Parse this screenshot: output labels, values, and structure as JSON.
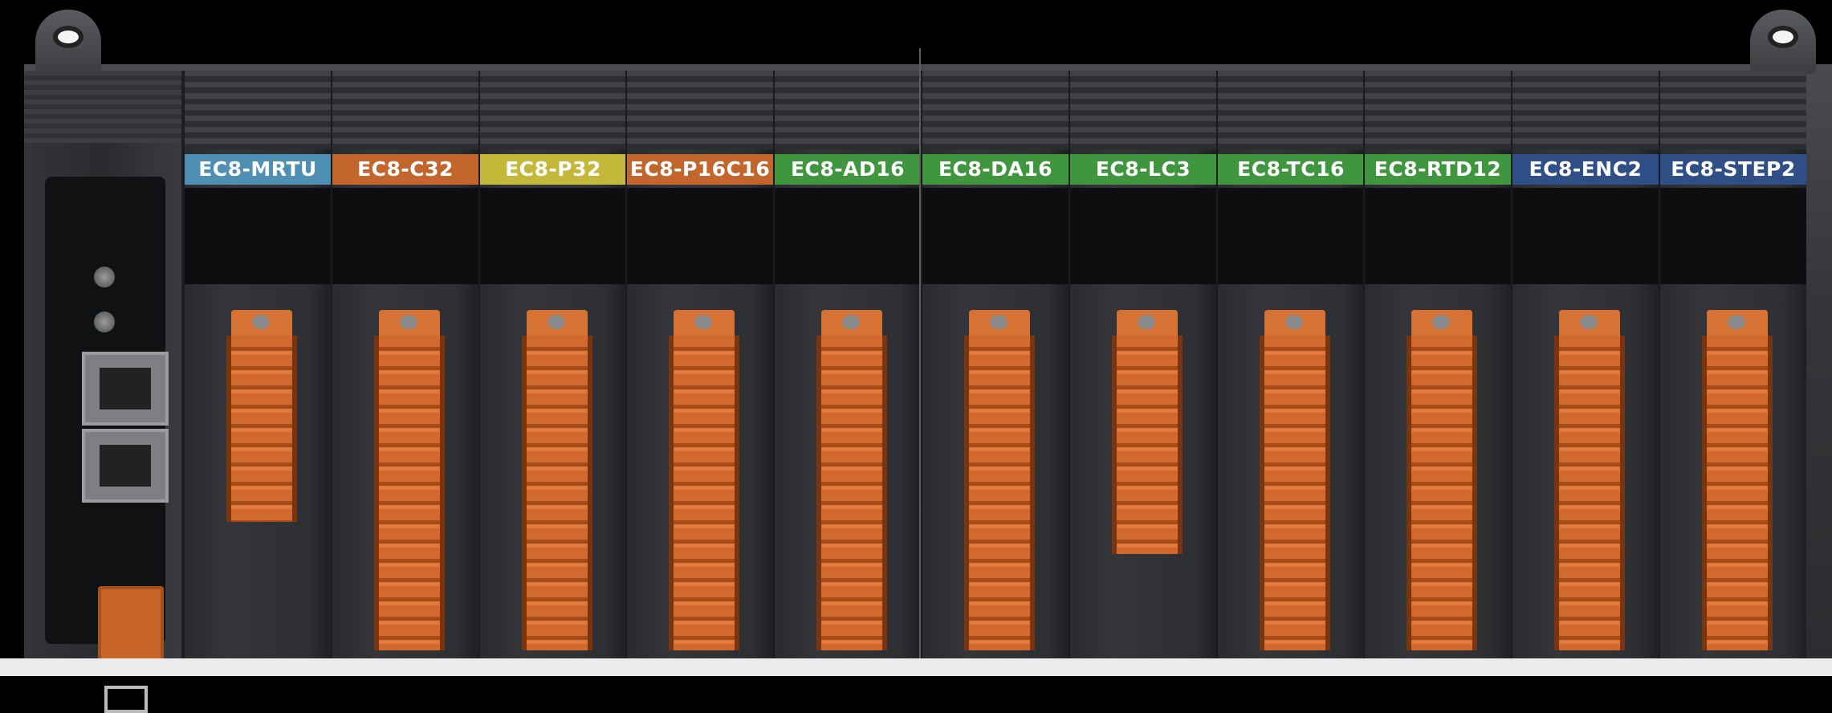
{
  "modules": [
    {
      "label": "EC8-MRTU",
      "color": "#4f8fb3",
      "terminal": "short"
    },
    {
      "label": "EC8-C32",
      "color": "#c2662e",
      "terminal": "long"
    },
    {
      "label": "EC8-P32",
      "color": "#c3b83a",
      "terminal": "long"
    },
    {
      "label": "EC8-P16C16",
      "color": "#c2662e",
      "terminal": "long"
    },
    {
      "label": "EC8-AD16",
      "color": "#3f963f",
      "terminal": "long"
    },
    {
      "label": "EC8-DA16",
      "color": "#3f963f",
      "terminal": "long"
    },
    {
      "label": "EC8-LC3",
      "color": "#3f963f",
      "terminal": "medium"
    },
    {
      "label": "EC8-TC16",
      "color": "#3f963f",
      "terminal": "long"
    },
    {
      "label": "EC8-RTD12",
      "color": "#3f963f",
      "terminal": "long"
    },
    {
      "label": "EC8-ENC2",
      "color": "#2f4f86",
      "terminal": "long"
    },
    {
      "label": "EC8-STEP2",
      "color": "#2f4f86",
      "terminal": "long"
    }
  ]
}
